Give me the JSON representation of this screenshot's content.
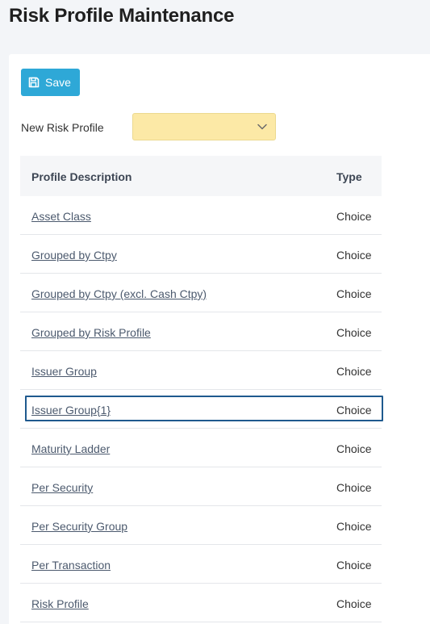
{
  "header": {
    "title": "Risk Profile Maintenance"
  },
  "toolbar": {
    "save_label": "Save",
    "save_icon": "floppy-disk-icon"
  },
  "form": {
    "new_risk_profile_label": "New Risk Profile",
    "new_risk_profile_value": "",
    "select_icon": "chevron-down-icon"
  },
  "table": {
    "columns": [
      "Profile Description",
      "Type"
    ],
    "rows": [
      {
        "description": "Asset Class",
        "type": "Choice",
        "selected": false
      },
      {
        "description": "Grouped by Ctpy",
        "type": "Choice",
        "selected": false
      },
      {
        "description": "Grouped by Ctpy (excl. Cash Ctpy)",
        "type": "Choice",
        "selected": false
      },
      {
        "description": "Grouped by Risk Profile",
        "type": "Choice",
        "selected": false
      },
      {
        "description": "Issuer Group",
        "type": "Choice",
        "selected": false
      },
      {
        "description": "Issuer Group{1}",
        "type": "Choice",
        "selected": true
      },
      {
        "description": "Maturity Ladder",
        "type": "Choice",
        "selected": false
      },
      {
        "description": "Per Security",
        "type": "Choice",
        "selected": false
      },
      {
        "description": "Per Security Group",
        "type": "Choice",
        "selected": false
      },
      {
        "description": "Per Transaction",
        "type": "Choice",
        "selected": false
      },
      {
        "description": "Risk Profile",
        "type": "Choice",
        "selected": false
      }
    ]
  },
  "colors": {
    "accent": "#2ea8d7",
    "select_bg": "#fce9a6",
    "selection_border": "#1f5a8e"
  }
}
